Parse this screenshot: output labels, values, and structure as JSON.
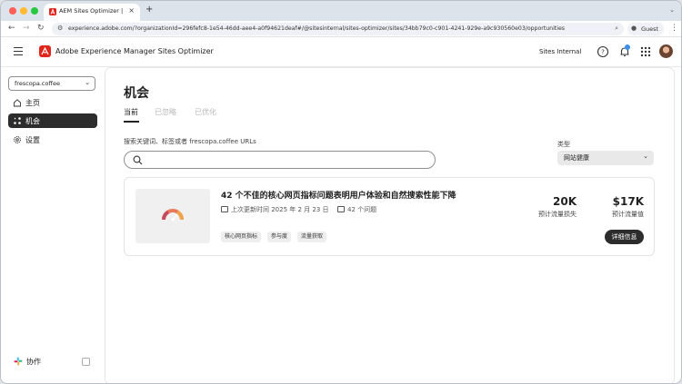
{
  "browser": {
    "tab_title": "AEM Sites Optimizer | Adob",
    "tab_close": "×",
    "new_tab": "+",
    "url": "experience.adobe.com/?organizationId=296fefc8-1e54-46dd-aee4-a0f94621deaf#/@sitesinternal/sites-optimizer/sites/34bb79c0-c901-4241-929e-a9c930560e03/opportunities",
    "profile_label": "Guest"
  },
  "header": {
    "app_title": "Adobe Experience Manager Sites Optimizer",
    "org_name": "Sites Internal",
    "accent_color": "#e1251b",
    "notification_color": "#3a8fe8"
  },
  "sidebar": {
    "site_select": "frescopa.coffee",
    "items": [
      {
        "label": "主页",
        "icon": "home-icon",
        "active": false
      },
      {
        "label": "机会",
        "icon": "opportunities-icon",
        "active": true
      },
      {
        "label": "设置",
        "icon": "settings-icon",
        "active": false
      }
    ],
    "collaborate_label": "协作"
  },
  "main": {
    "page_title": "机会",
    "tabs": [
      {
        "label": "当前",
        "selected": true
      },
      {
        "label": "已忽略",
        "selected": false
      },
      {
        "label": "已优化",
        "selected": false
      }
    ],
    "search_label": "搜索关键词、标签或者 frescopa.coffee URLs",
    "search_value": "",
    "type_label": "类型",
    "type_value": "网站健康",
    "card": {
      "title": "42 个不佳的核心网页指标问题表明用户体验和自然搜索性能下降",
      "updated": "上次更新时间 2025 年 2 月 23 日",
      "issues": "42 个问题",
      "tags": [
        "核心网页指标",
        "参与度",
        "流量获取"
      ],
      "metric1_value": "20K",
      "metric1_label": "预计流量损失",
      "metric2_value": "$17K",
      "metric2_label": "预计流量值",
      "details_button": "详细信息"
    }
  }
}
